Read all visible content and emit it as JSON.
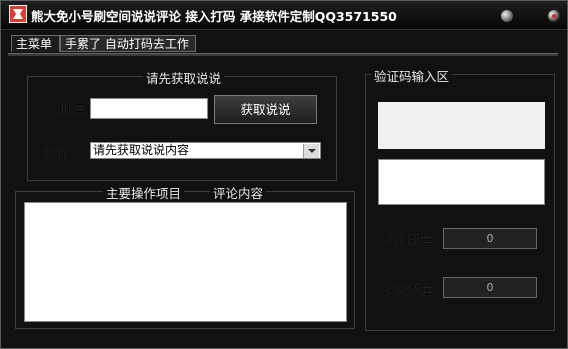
{
  "window": {
    "title": "熊大免小号刷空间说说评论  接入打码  承接软件定制QQ3571550"
  },
  "tabs": [
    {
      "label": "主菜单"
    },
    {
      "label": "手累了 自动打码去工作"
    }
  ],
  "get_posts_group": {
    "title": "请先获取说说",
    "qq_label": "QQ账号：",
    "qq_value": "",
    "fetch_button": "获取说说",
    "post_label": "说说：",
    "post_select_value": "请先获取说说内容"
  },
  "main_ops_group": {
    "title_left": "主要操作项目",
    "title_right": "评论内容"
  },
  "captcha_group": {
    "title": "验证码输入区",
    "success_label": "成功数量：",
    "success_count": "0",
    "fail_label": "失败数量：",
    "fail_count": "0"
  },
  "icons": {
    "app": "app-logo-icon",
    "minimize": "minimize-icon",
    "close": "close-icon"
  }
}
